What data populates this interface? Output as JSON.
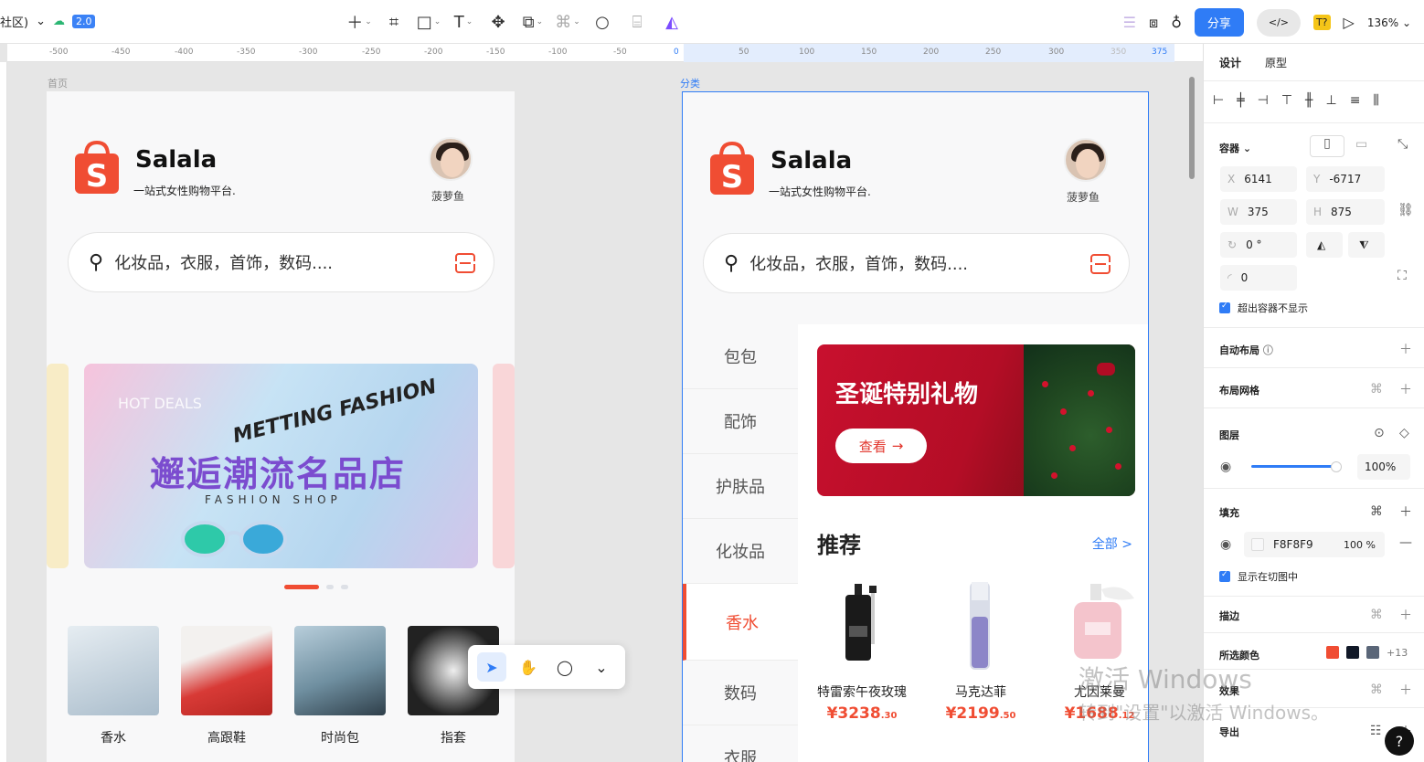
{
  "toolbar": {
    "community_label": "社区)",
    "version_badge": "2.0",
    "share_label": "分享",
    "code_label": "</>",
    "t_badge": "T?",
    "zoom": "136%"
  },
  "ruler": {
    "ticks": [
      "-500",
      "-450",
      "-400",
      "-350",
      "-300",
      "-250",
      "-200",
      "-150",
      "-100",
      "-50",
      "0",
      "50",
      "100",
      "150",
      "200",
      "250",
      "300",
      "350",
      "375"
    ]
  },
  "frames": {
    "left_label": "首页",
    "right_label": "分类"
  },
  "home": {
    "brand": "Salala",
    "tagline": "一站式女性购物平台.",
    "user_name": "菠萝鱼",
    "search_placeholder": "化妆品，衣服，首饰，数码....",
    "banner": {
      "hot_deals": "HOT DEALS",
      "metting": "METTING FASHION",
      "main": "邂逅潮流名品店",
      "sub": "FASHION SHOP"
    },
    "categories": [
      {
        "label": "香水",
        "color": "#c9d6de"
      },
      {
        "label": "高跟鞋",
        "color": "#d83a36"
      },
      {
        "label": "时尚包",
        "color": "#6f8fa0"
      },
      {
        "label": "指套",
        "color": "#333333"
      }
    ]
  },
  "category_page": {
    "brand": "Salala",
    "tagline": "一站式女性购物平台.",
    "user_name": "菠萝鱼",
    "search_placeholder": "化妆品，衣服，首饰，数码....",
    "nav": [
      "包包",
      "配饰",
      "护肤品",
      "化妆品",
      "香水",
      "数码",
      "衣服"
    ],
    "active_nav": "香水",
    "banner_title": "圣诞特别礼物",
    "banner_button": "查看",
    "rec_title": "推荐",
    "rec_all": "全部 >",
    "products": [
      {
        "name": "特雷索午夜玫瑰",
        "price": "¥3238",
        "cents": ".30"
      },
      {
        "name": "马克达菲",
        "price": "¥2199",
        "cents": ".50"
      },
      {
        "name": "尤因莱曼",
        "price": "¥1688",
        "cents": ".12"
      }
    ]
  },
  "panel": {
    "tabs": [
      "设计",
      "原型"
    ],
    "container_label": "容器",
    "x_label": "X",
    "x_value": "6141",
    "y_label": "Y",
    "y_value": "-6717",
    "w_label": "W",
    "w_value": "375",
    "h_label": "H",
    "h_value": "875",
    "rotation": "0 °",
    "radius": "0",
    "clip_label": "超出容器不显示",
    "auto_layout": "自动布局",
    "layout_grid": "布局网格",
    "layer": "图层",
    "opacity": "100%",
    "fill": "填充",
    "fill_hex": "F8F8F9",
    "fill_opacity": "100 %",
    "show_in_slice": "显示在切图中",
    "stroke": "描边",
    "selected_colors": "所选颜色",
    "more_colors": "+13",
    "effects": "效果",
    "export": "导出"
  },
  "selected_color_swatches": [
    "#f04d33",
    "#111827",
    "#5a6678"
  ],
  "watermark": {
    "line1": "激活 Windows",
    "line2": "转到\"设置\"以激活 Windows。"
  },
  "help_label": "?"
}
